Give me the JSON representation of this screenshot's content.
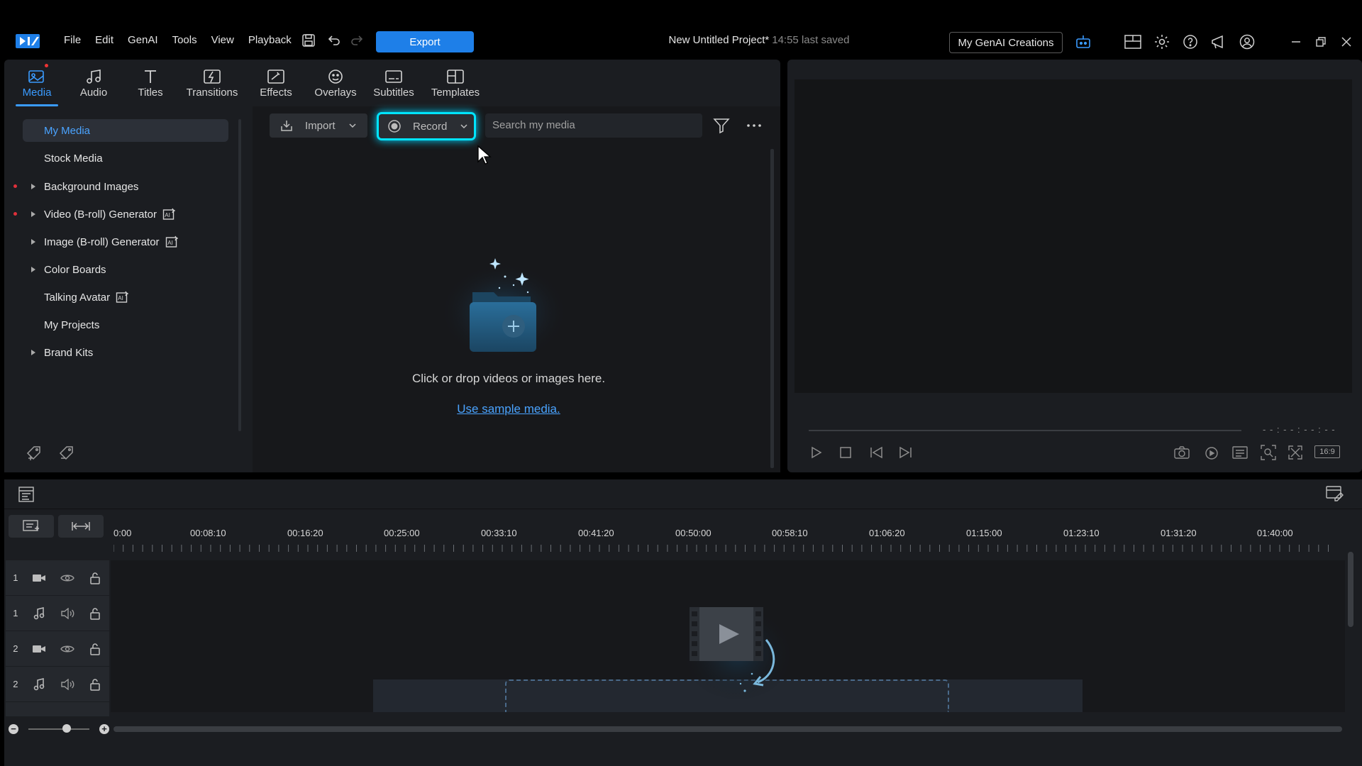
{
  "menu": [
    "File",
    "Edit",
    "GenAI",
    "Tools",
    "View",
    "Playback"
  ],
  "toolbar": {
    "export_label": "Export"
  },
  "project": {
    "title": "New Untitled Project*",
    "saved": "14:55 last saved"
  },
  "header_right": {
    "genai_creations_label": "My GenAI Creations"
  },
  "tabs": [
    {
      "label": "Media",
      "icon": "media-icon"
    },
    {
      "label": "Audio",
      "icon": "music-note-icon"
    },
    {
      "label": "Titles",
      "icon": "title-t-icon"
    },
    {
      "label": "Transitions",
      "icon": "transition-icon"
    },
    {
      "label": "Effects",
      "icon": "effects-icon"
    },
    {
      "label": "Overlays",
      "icon": "overlays-icon"
    },
    {
      "label": "Subtitles",
      "icon": "subtitles-icon"
    },
    {
      "label": "Templates",
      "icon": "templates-icon"
    }
  ],
  "sidebar": {
    "items": [
      {
        "label": "My Media"
      },
      {
        "label": "Stock Media"
      },
      {
        "label": "Background Images"
      },
      {
        "label": "Video (B-roll) Generator"
      },
      {
        "label": "Image (B-roll) Generator"
      },
      {
        "label": "Color Boards"
      },
      {
        "label": "Talking Avatar"
      },
      {
        "label": "My Projects"
      },
      {
        "label": "Brand Kits"
      }
    ]
  },
  "media": {
    "import_label": "Import",
    "record_label": "Record",
    "search_placeholder": "Search my media",
    "drop_text": "Click or drop videos or images here.",
    "sample_link": "Use sample media."
  },
  "preview": {
    "timecode": "- - : - - : - - : - -",
    "aspect_ratio": "16:9"
  },
  "timeline": {
    "ruler": [
      "0:00",
      "00:08:10",
      "00:16:20",
      "00:25:00",
      "00:33:10",
      "00:41:20",
      "00:50:00",
      "00:58:10",
      "01:06:20",
      "01:15:00",
      "01:23:10",
      "01:31:20",
      "01:40:00"
    ],
    "tracks": [
      {
        "num": "1",
        "type": "video"
      },
      {
        "num": "1",
        "type": "audio"
      },
      {
        "num": "2",
        "type": "video"
      },
      {
        "num": "2",
        "type": "audio"
      }
    ]
  },
  "colors": {
    "accent": "#1e7fe8",
    "highlight": "#00e5ff",
    "active_tab": "#3a9bff"
  }
}
